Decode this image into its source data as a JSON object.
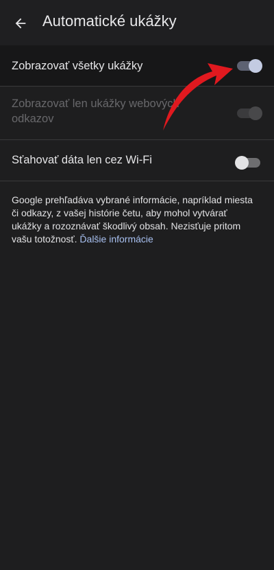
{
  "header": {
    "title": "Automatické ukážky",
    "back_icon": "arrow-back-icon"
  },
  "settings": {
    "show_all_previews": {
      "label": "Zobrazovať všetky ukážky",
      "state": "on"
    },
    "show_web_link_previews": {
      "label": "Zobrazovať len ukážky webových odkazov",
      "state": "on-disabled"
    },
    "wifi_only": {
      "label": "Sťahovať dáta len cez Wi-Fi",
      "state": "off"
    }
  },
  "description": {
    "text": "Google prehľadáva vybrané informácie, napríklad miesta či odkazy, z vašej histórie četu, aby mohol vytvárať ukážky a rozoznávať škodlivý obsah. Nezisťuje pritom vašu totožnosť.",
    "link": "Ďalšie informácie"
  },
  "colors": {
    "background": "#1e1e1f",
    "text": "#e6e6e8",
    "disabled_text": "#68686b",
    "link": "#a8c0f0",
    "toggle_on_knob": "#c3cbe2",
    "annotation_arrow": "#e0191f"
  }
}
